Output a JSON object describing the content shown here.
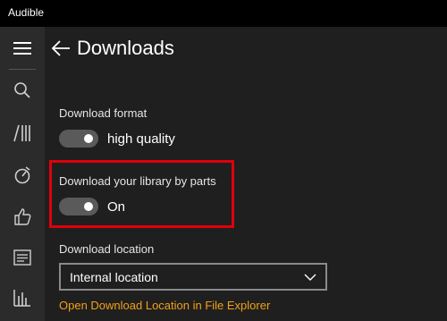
{
  "app": {
    "title": "Audible"
  },
  "sidebar": {
    "items": [
      {
        "icon": "menu-icon"
      },
      {
        "icon": "search-icon"
      },
      {
        "icon": "library-icon"
      },
      {
        "icon": "discover-icon"
      },
      {
        "icon": "thumbs-up-icon"
      },
      {
        "icon": "news-icon"
      },
      {
        "icon": "stats-icon"
      }
    ]
  },
  "header": {
    "title": "Downloads",
    "back_icon": "back-arrow-icon"
  },
  "settings": {
    "format": {
      "label": "Download format",
      "value": "high quality",
      "on": true
    },
    "parts": {
      "label": "Download your library by parts",
      "value": "On",
      "on": true
    },
    "location": {
      "label": "Download location",
      "selected": "Internal location",
      "link": "Open Download Location in File Explorer"
    }
  },
  "colors": {
    "accent_link": "#f0a017",
    "highlight_border": "#e0000a",
    "background": "#1f1f1f",
    "sidebar": "#2b2b2b"
  }
}
